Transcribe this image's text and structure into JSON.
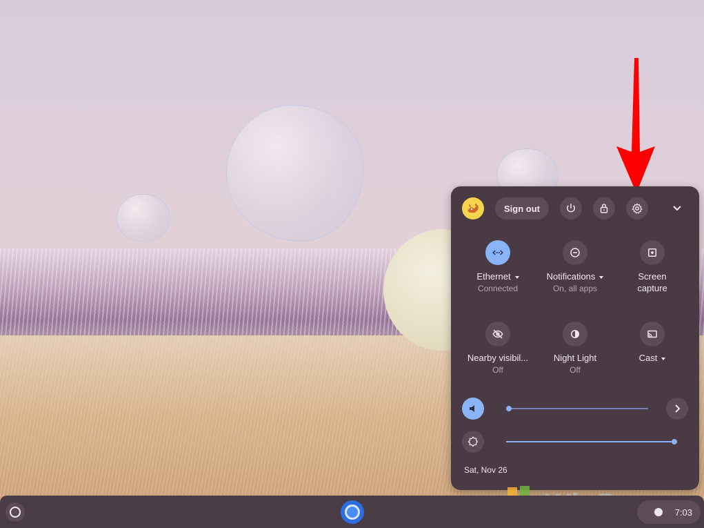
{
  "quick_settings": {
    "sign_out_label": "Sign out",
    "tiles": [
      {
        "label": "Ethernet",
        "sublabel": "Connected",
        "icon": "ethernet-icon",
        "active": true,
        "has_menu": true
      },
      {
        "label": "Notifications",
        "sublabel": "On, all apps",
        "icon": "notifications-icon",
        "active": false,
        "has_menu": true
      },
      {
        "label": "Screen",
        "label2": "capture",
        "sublabel": "",
        "icon": "screen-capture-icon",
        "active": false,
        "has_menu": false
      },
      {
        "label": "Nearby visibil...",
        "sublabel": "Off",
        "icon": "nearby-visibility-icon",
        "active": false,
        "has_menu": false
      },
      {
        "label": "Night Light",
        "sublabel": "Off",
        "icon": "night-light-icon",
        "active": false,
        "has_menu": false
      },
      {
        "label": "Cast",
        "sublabel": "",
        "icon": "cast-icon",
        "active": false,
        "has_menu": true
      }
    ],
    "volume_level": 0.0,
    "brightness_level": 1.0,
    "date": "Sat, Nov 26"
  },
  "shelf": {
    "time": "7:03"
  },
  "watermark": {
    "text": "WinBuzzer"
  },
  "colors": {
    "panel_bg": "#4a3a44",
    "accent": "#8ab4f8",
    "arrow": "#ff0000"
  }
}
